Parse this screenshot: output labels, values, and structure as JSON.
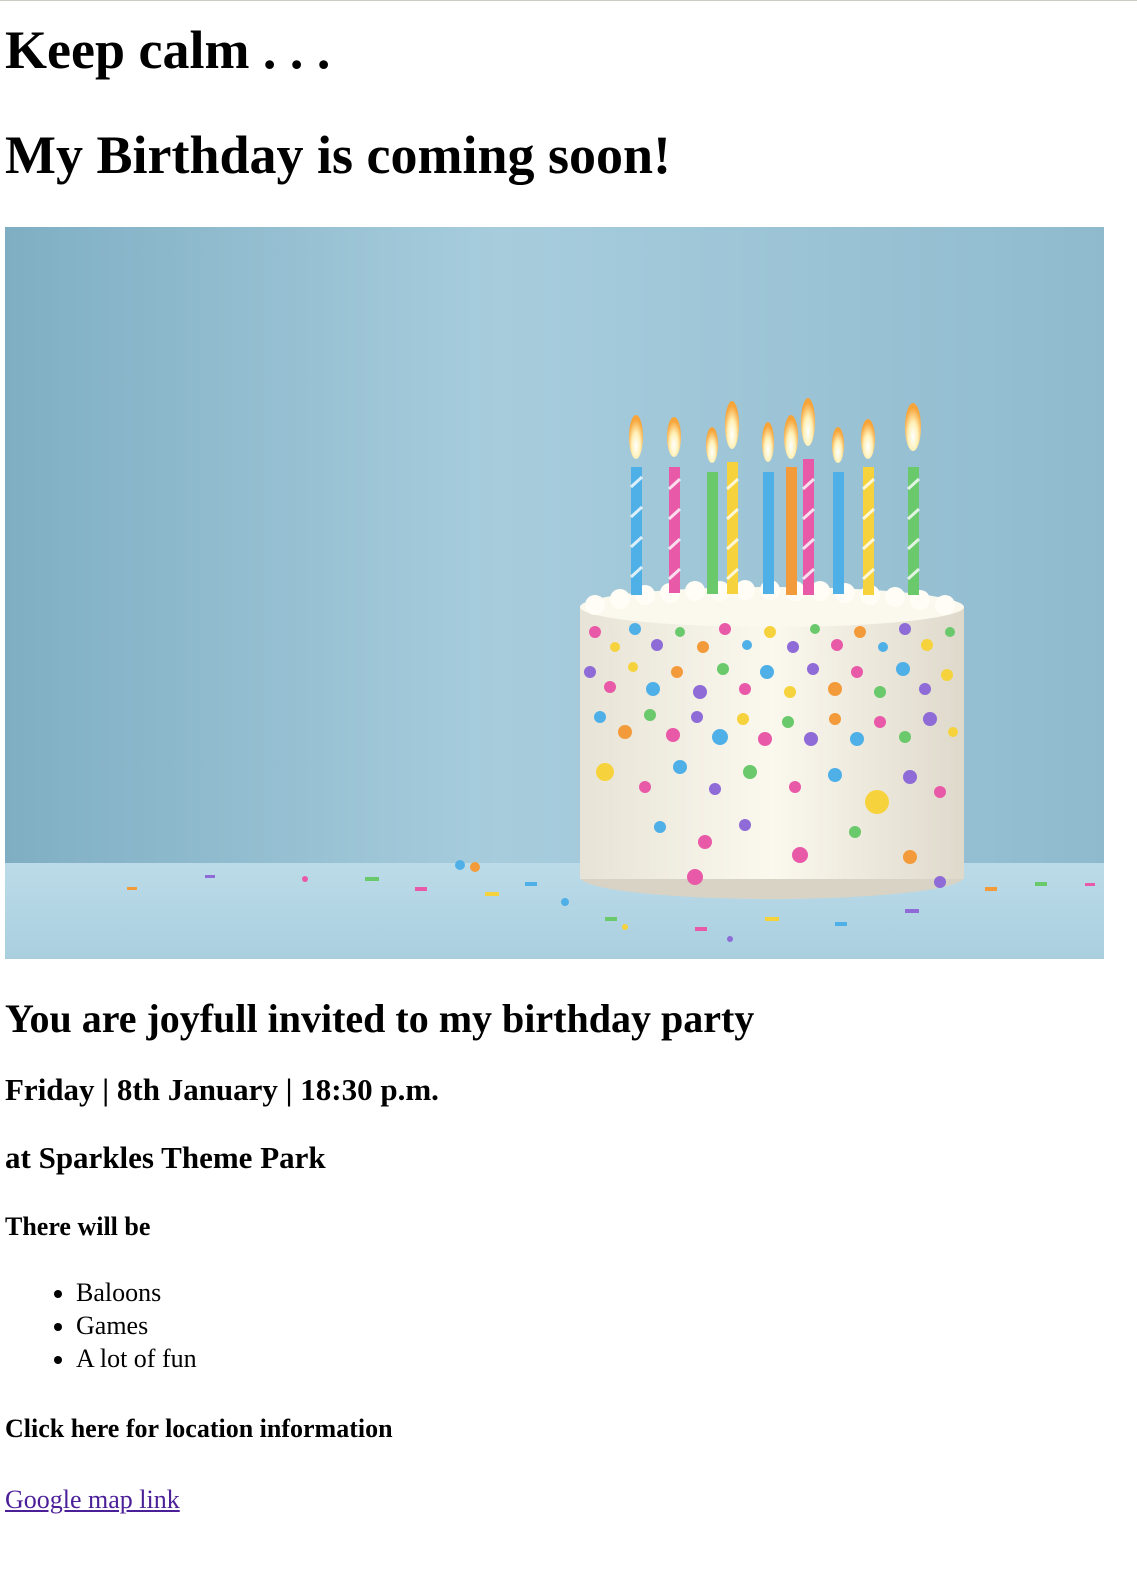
{
  "heading_1": "Keep calm . . .",
  "heading_2": "My Birthday is coming soon!",
  "hero_image": {
    "alt": "",
    "icon": "birthday-cake-image"
  },
  "invite_heading": "You are joyfull invited to my birthday party",
  "date_line": "Friday | 8th January | 18:30 p.m.",
  "place_line": "at Sparkles Theme Park",
  "list_heading": "There will be",
  "list_items": [
    "Baloons",
    "Games",
    "A lot of fun"
  ],
  "location_heading": "Click here for location information",
  "map_link_text": "Google map link",
  "colors": {
    "link": "#4b1f98",
    "background": "#ffffff",
    "sky": "#9cc5d6"
  }
}
